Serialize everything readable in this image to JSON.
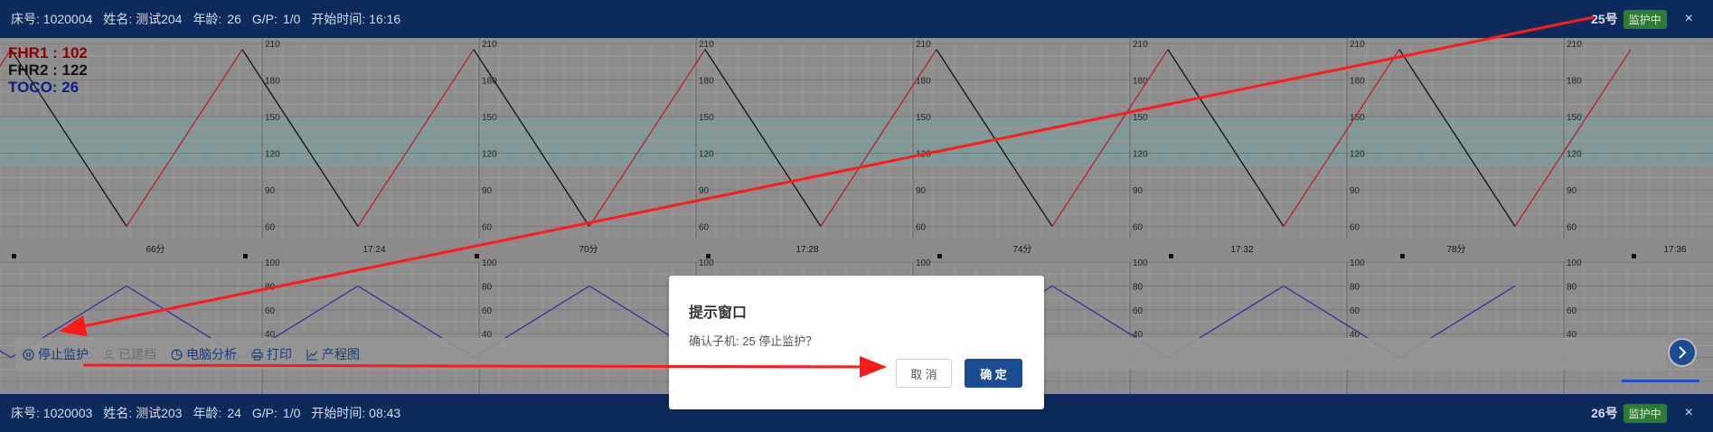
{
  "top_monitor": {
    "bed_label": "床号: 1020004",
    "name_label": "姓名: 测试204",
    "age_label": "年龄:",
    "age_value": "26",
    "gp_label": "G/P:",
    "gp_value": "1/0",
    "start_label": "开始时间: 16:16",
    "unit": "25号",
    "status": "监护中",
    "close": "×"
  },
  "bottom_monitor": {
    "bed_label": "床号: 1020003",
    "name_label": "姓名: 测试203",
    "age_label": "年龄:",
    "age_value": "24",
    "gp_label": "G/P:",
    "gp_value": "1/0",
    "start_label": "开始时间: 08:43",
    "unit": "26号",
    "status": "监护中",
    "close": "×"
  },
  "readouts": {
    "fhr1": "FHR1 : 102",
    "fhr2": "FHR2 : 122",
    "toco": "TOCO: 26"
  },
  "chart_data": {
    "type": "line",
    "fhr_scale_ticks": [
      "210",
      "180",
      "150",
      "120",
      "90",
      "60"
    ],
    "toco_scale_ticks": [
      "100",
      "80",
      "60",
      "40"
    ],
    "time_labels": [
      "66分",
      "17:24",
      "70分",
      "17:28",
      "74分",
      "17:32",
      "78分",
      "17:36"
    ],
    "fhr_range": [
      50,
      210
    ],
    "toco_range": [
      0,
      100
    ],
    "fhr_series_values": [
      60,
      205,
      60,
      205,
      60,
      205,
      60,
      205,
      60,
      205,
      60,
      205,
      60,
      205,
      60,
      205
    ],
    "toco_series_values": [
      80,
      20,
      80,
      20,
      80,
      20,
      80,
      20,
      80,
      20,
      80,
      20,
      80,
      20,
      80
    ],
    "colors": {
      "fhr1": "#b22222",
      "fhr2": "#111111",
      "toco": "#2a2aa8"
    }
  },
  "toolbar": {
    "stop": "停止监护",
    "archived": "已建档",
    "analysis": "电脑分析",
    "print": "打印",
    "partogram": "产程图"
  },
  "dialog": {
    "title": "提示窗口",
    "message": "确认子机: 25 停止监护？",
    "cancel": "取 消",
    "confirm": "确 定"
  },
  "colors": {
    "header_bg": "#0d2a5c",
    "status_badge": "#2e7d32",
    "primary_button": "#1b4b93",
    "annotation_arrow": "#ff1a1a"
  }
}
